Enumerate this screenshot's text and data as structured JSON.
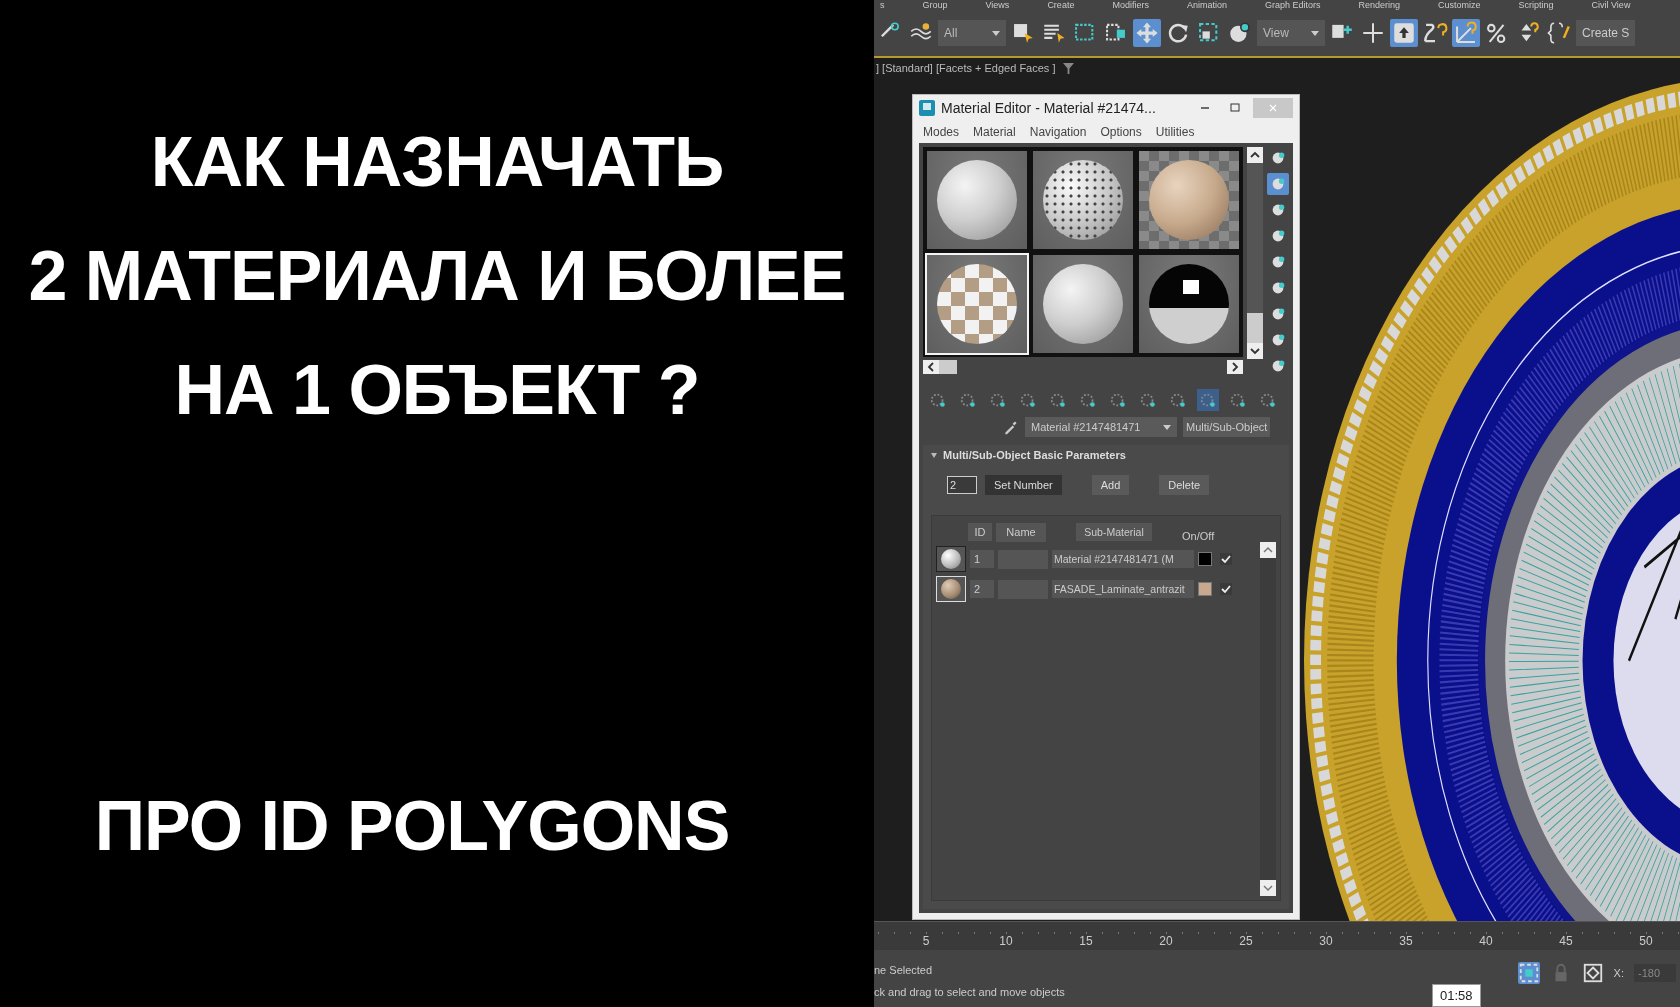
{
  "headline": {
    "lines": [
      "КАК НАЗНАЧАТЬ",
      "2 МАТЕРИАЛА И БОЛЕЕ",
      "НА 1 ОБЪЕКТ ?"
    ],
    "footer": "ПРО ID POLYGONS"
  },
  "menu": [
    "s",
    "Group",
    "Views",
    "Create",
    "Modifiers",
    "Animation",
    "Graph Editors",
    "Rendering",
    "Customize",
    "Scripting",
    "Civil View"
  ],
  "toolbar": [
    {
      "kind": "link",
      "active": false
    },
    {
      "kind": "bind",
      "active": false
    },
    {
      "kind": "dropdown",
      "value": "All"
    },
    {
      "kind": "select",
      "active": false
    },
    {
      "kind": "select-list",
      "active": false
    },
    {
      "kind": "region",
      "active": false
    },
    {
      "kind": "window",
      "active": false
    },
    {
      "kind": "move",
      "active": true
    },
    {
      "kind": "rotate",
      "active": false
    },
    {
      "kind": "scale",
      "active": false
    },
    {
      "kind": "place",
      "active": false
    },
    {
      "kind": "dropdown",
      "value": "View"
    },
    {
      "kind": "pivot",
      "active": false
    },
    {
      "kind": "axis",
      "active": false
    },
    {
      "kind": "keyboard",
      "active": true
    },
    {
      "kind": "snap",
      "active": false
    },
    {
      "kind": "angle-snap",
      "active": true
    },
    {
      "kind": "percent-snap",
      "active": false
    },
    {
      "kind": "spinner-snap",
      "active": false
    },
    {
      "kind": "brackets",
      "active": false
    },
    {
      "kind": "button",
      "label": "Create S"
    }
  ],
  "viewport_label": "] [Standard] [Facets + Edged Faces ]",
  "material_editor": {
    "title": "Material Editor - Material #21474...",
    "menus": [
      "Modes",
      "Material",
      "Navigation",
      "Options",
      "Utilities"
    ],
    "slots": [
      {
        "kind": "matte",
        "selected": false
      },
      {
        "kind": "dotted",
        "selected": false
      },
      {
        "kind": "backlit",
        "selected": false
      },
      {
        "kind": "checker",
        "selected": true
      },
      {
        "kind": "matte",
        "selected": false
      },
      {
        "kind": "chrome",
        "selected": false
      }
    ],
    "side_tools": [
      {
        "active": false
      },
      {
        "active": true
      },
      {
        "active": false
      },
      {
        "active": false
      },
      {
        "active": false
      },
      {
        "active": false
      },
      {
        "active": false
      },
      {
        "active": false
      },
      {
        "active": false
      }
    ],
    "bottom_tools": [
      {
        "active": false
      },
      {
        "active": false
      },
      {
        "active": false
      },
      {
        "active": false
      },
      {
        "active": false
      },
      {
        "active": false
      },
      {
        "active": false
      },
      {
        "active": false
      },
      {
        "active": false
      },
      {
        "active": true
      },
      {
        "active": false
      },
      {
        "active": false
      }
    ],
    "material_name": "Material #2147481471",
    "material_type": "Multi/Sub-Object",
    "rollout_title": "Multi/Sub-Object Basic Parameters",
    "count": "2",
    "buttons": [
      "Set Number",
      "Add",
      "Delete"
    ],
    "columns": [
      "ID",
      "Name",
      "Sub-Material",
      "On/Off"
    ],
    "rows": [
      {
        "id": "1",
        "sub_material": "Material #2147481471  (M",
        "color": "#000000",
        "on": true,
        "selected": false,
        "kind": "white"
      },
      {
        "id": "2",
        "sub_material": "FASADE_Laminate_antrazit",
        "color": "#c9a98d",
        "on": true,
        "selected": true,
        "kind": "beige"
      }
    ]
  },
  "timeline": [
    "5",
    "10",
    "15",
    "20",
    "25",
    "30",
    "35",
    "40",
    "45",
    "50"
  ],
  "status": {
    "selection": "ne Selected",
    "prompt": "ck and drag to select and move objects",
    "coord_label": "X:",
    "coord_value": "-180",
    "time": "01:58"
  }
}
